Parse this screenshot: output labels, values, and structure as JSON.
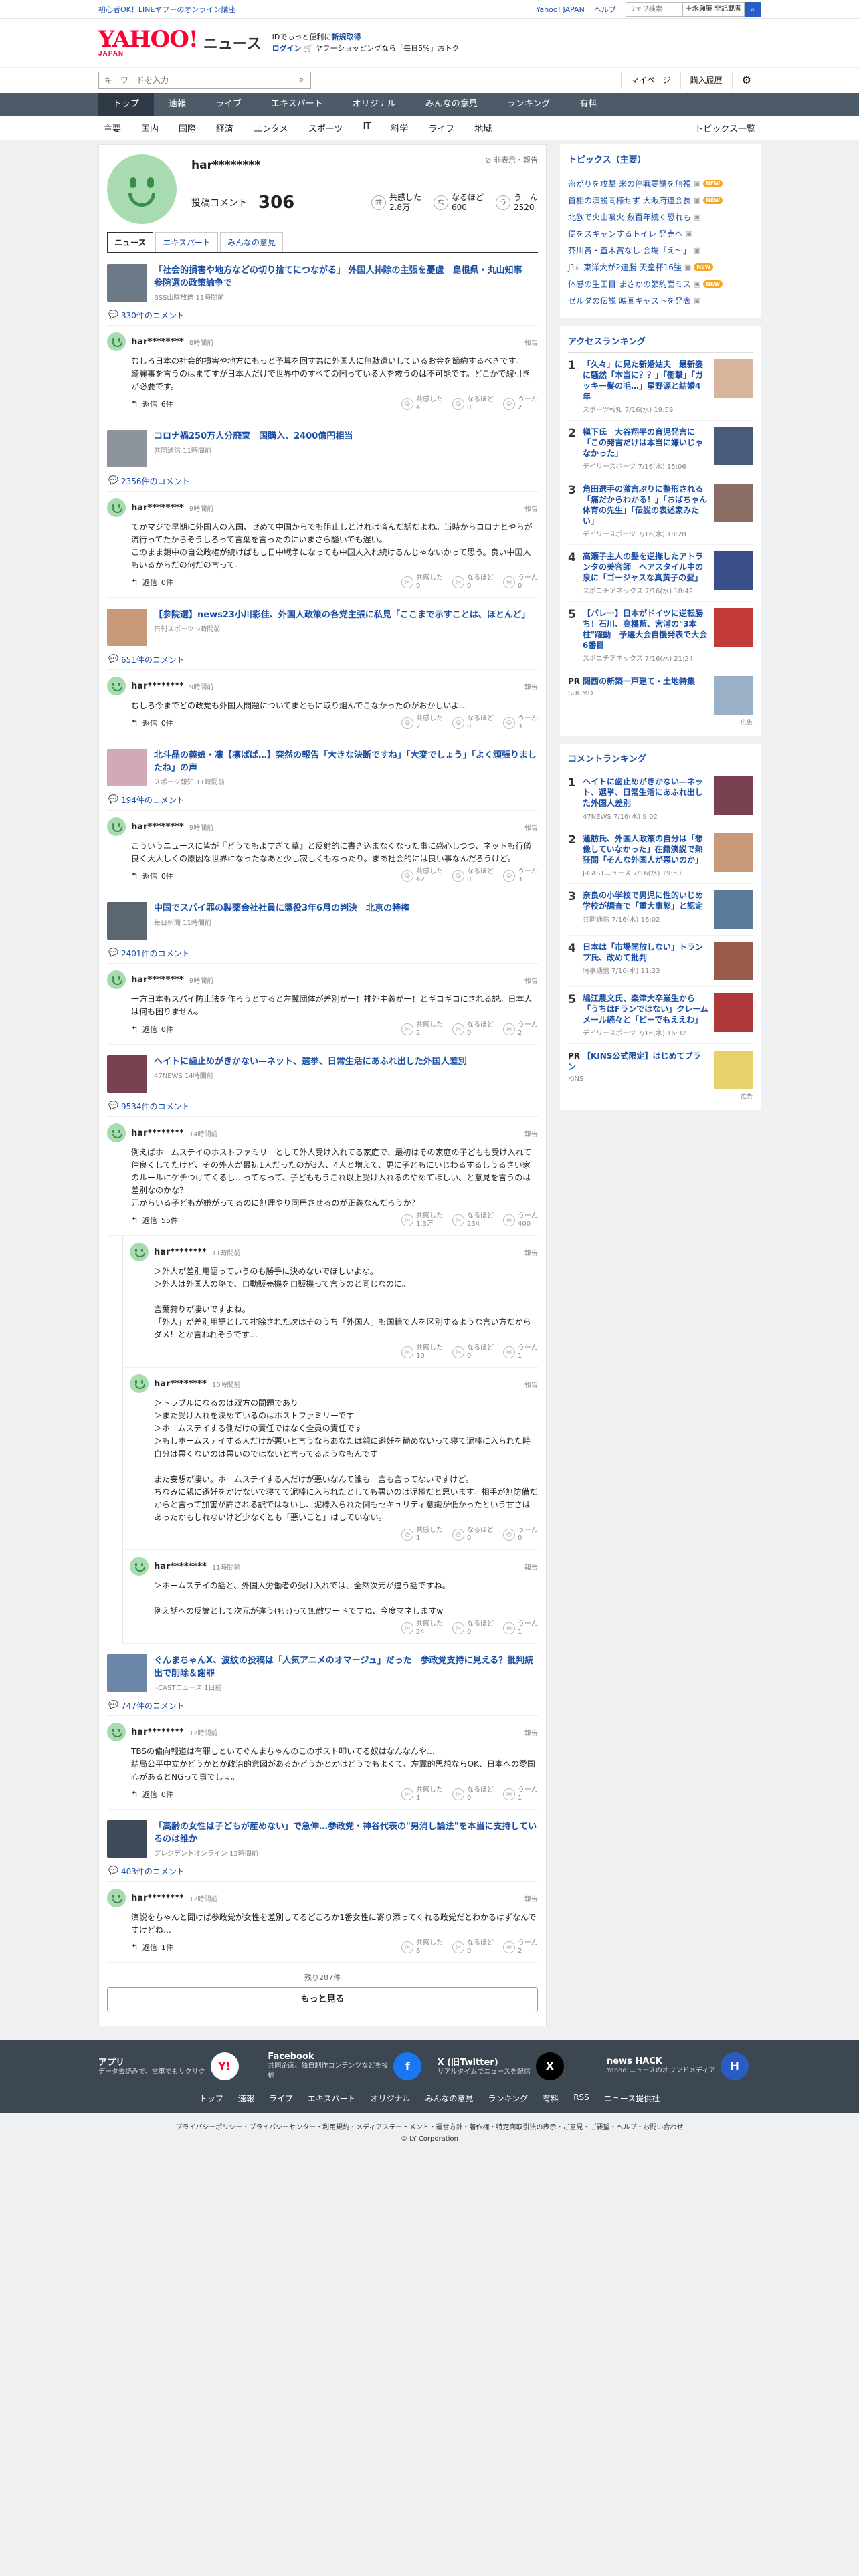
{
  "topbar": {
    "promo": "初心者OK！LINEヤフーのオンライン講座",
    "links": [
      "Yahoo! JAPAN",
      "ヘルプ"
    ],
    "search_placeholder": "ウェブ検索",
    "search_scope": "＋永瀬廉 非記載者"
  },
  "header": {
    "logo": "YAHOO!",
    "logo_sub": "JAPAN",
    "product": "ニュース",
    "msg1": "IDでもっと便利に",
    "msg1_link": "新規取得",
    "msg2_login": "ログイン",
    "msg2_rest": "ヤフーショッピングなら「毎日5%」おトク"
  },
  "search": {
    "placeholder": "キーワードを入力",
    "links": [
      "マイページ",
      "購入履歴"
    ]
  },
  "nav": [
    "トップ",
    "速報",
    "ライブ",
    "エキスパート",
    "オリジナル",
    "みんなの意見",
    "ランキング",
    "有料"
  ],
  "subnav": [
    "主要",
    "国内",
    "国際",
    "経済",
    "エンタメ",
    "スポーツ",
    "IT",
    "科学",
    "ライフ",
    "地域"
  ],
  "subnav_all": "トピックス一覧",
  "profile": {
    "name": "har********",
    "report": "非表示・報告",
    "comments_label": "投稿コメント",
    "comments_count": "306",
    "reacts": [
      {
        "icon": "共",
        "label": "共感した",
        "value": "2.8万"
      },
      {
        "icon": "な",
        "label": "なるほど",
        "value": "600"
      },
      {
        "icon": "う",
        "label": "うーん",
        "value": "2520"
      }
    ],
    "tabs": [
      "ニュース",
      "エキスパート",
      "みんなの意見"
    ]
  },
  "labels": {
    "reply": "返信",
    "report": "報告",
    "agree": "共感した",
    "naruhodo": "なるほど",
    "uun": "うーん"
  },
  "entries": [
    {
      "title": "「社会的損害や地方などの切り捨てにつながる」 外国人排除の主張を憂慮　島根県・丸山知事　参院選の政策論争で",
      "source": "BSS山陰放送 11時間前",
      "thumb": "#6c7a88",
      "count": "330件のコメント",
      "comments": [
        {
          "name": "har********",
          "time": "8時間前",
          "body": "むしろ日本の社会的損害や地方にもっと予算を回す為に外国人に無駄遣いしているお金を節約するべきです。\n綺麗事を言うのはまてすが日本人だけで世界中のすべての困っている人を救うのは不可能です。どこかで線引きが必要です。",
          "replies": "6件",
          "agree": "4",
          "naru": "0",
          "uun": "2",
          "reply": false
        }
      ]
    },
    {
      "title": "コロナ禍250万人分廃棄　国購入、2400億円相当",
      "source": "共同通信 11時間前",
      "thumb": "#8d949b",
      "count": "2356件のコメント",
      "comments": [
        {
          "name": "har********",
          "time": "9時間前",
          "body": "てかマジで早期に外国人の入国、せめて中国からでも阻止しとければ済んだ話だよね。当時からコロナとやらが流行ってたからそうしろって言葉を言ったのにいまさら騒いでも遅い。\nこのまま鎖中の自公政権が続けばもし日中戦争になっても中国人入れ続けるんじゃないかって思う。良い中国人もいるからだの何だの言って。",
          "replies": "0件",
          "agree": "0",
          "naru": "0",
          "uun": "0",
          "reply": false
        }
      ]
    },
    {
      "title": "【参院選】news23小川彩佳、外国人政策の各党主張に私見「ここまで示すことは、ほとんど」",
      "source": "日刊スポーツ 9時間前",
      "thumb": "#c99a7a",
      "count": "651件のコメント",
      "comments": [
        {
          "name": "har********",
          "time": "9時間前",
          "body": "むしろ今までどの政党も外国人問題についてまともに取り組んでこなかったのがおかしいよ…",
          "replies": "0件",
          "agree": "2",
          "naru": "0",
          "uun": "3",
          "reply": false
        }
      ]
    },
    {
      "title": "北斗晶の義娘・凛【凛ぱぱ…】突然の報告「大きな決断ですね」「大変でしょう」「よく頑張りましたね」の声",
      "source": "スポーツ報知 11時間前",
      "thumb": "#d4a9b6",
      "count": "194件のコメント",
      "comments": [
        {
          "name": "har********",
          "time": "9時間前",
          "body": "こういうニュースに皆が『どうでもよすぎて草』と反射的に書き込まなくなった事に感心しつつ、ネットも行儀良く大人しくの原因な世界になったなあと少し寂しくもなったり。まあ社会的には良い事なんだろうけど。",
          "replies": "0件",
          "agree": "42",
          "naru": "0",
          "uun": "3",
          "reply": false
        }
      ]
    },
    {
      "title": "中国でスパイ罪の製薬会社社員に懲役3年6月の判決　北京の特権",
      "source": "毎日新聞 11時間前",
      "thumb": "#5c6670",
      "count": "2401件のコメント",
      "comments": [
        {
          "name": "har********",
          "time": "9時間前",
          "body": "一方日本もスパイ防止法を作ろうとすると左翼団体が差別が一！排外主義が一！とギコギコにされる説。日本人は何も困りません。",
          "replies": "0件",
          "agree": "2",
          "naru": "0",
          "uun": "2",
          "reply": false
        }
      ]
    },
    {
      "title": "ヘイトに歯止めがきかない—ネット、選挙、日常生活にあふれ出した外国人差別",
      "source": "47NEWS 14時間前",
      "thumb": "#7a4150",
      "count": "9534件のコメント",
      "comments": [
        {
          "name": "har********",
          "time": "14時間前",
          "body": "例えばホームステイのホストファミリーとして外人受け入れてる家庭で、最初はその家庭の子どもも受け入れて仲良くしてたけど、その外人が最初1人だったのが3人、4人と増えて、更に子どもにいじわるするしうるさい家のルールにケチつけてくるし…ってなって、子どももうこれ以上受け入れるのやめてほしい、と意見を言うのは差別なのかな？\n元からいる子どもが嫌がってるのに無理やり同居させるのが正義なんだろうか？",
          "replies": "55件",
          "agree": "1.3万",
          "naru": "234",
          "uun": "400",
          "reply": false
        },
        {
          "name": "har********",
          "time": "11時間前",
          "body": "＞外人が差別用語っていうのも勝手に決めないでほしいよな。\n＞外人は外国人の略で、自動販売機を自販機って言うのと同じなのに。\n\n言葉狩りが凄いですよね。\n「外人」が差別用語として排除された次はそのうち「外国人」も国籍で人を区別するような言い方だからダメ！とか言われそうです…",
          "replies": "",
          "agree": "10",
          "naru": "0",
          "uun": "1",
          "reply": true
        },
        {
          "name": "har********",
          "time": "10時間前",
          "body": "＞トラブルになるのは双方の問題であり\n＞また受け入れを決めているのはホストファミリーです\n＞ホームステイする側だけの責任ではなく全員の責任です\n＞もしホームステイする人だけが悪いと言うならあなたは親に避妊を勧めないって寝て泥棒に入られた時自分は悪くないのは悪いのではないと言ってるようなもんです\n\nまた妄想が凄い。ホームステイする人だけが悪いなんて誰も一言も言ってないですけど。\nちなみに親に避妊をかけないで寝てて泥棒に入られたとしても悪いのは泥棒だと思います。相手が無防備だからと言って加害が許される訳ではないし、泥棒入られた側もセキュリティ意識が低かったという甘さはあったかもしれないけど少なくとも「悪いこと」はしていない。",
          "replies": "",
          "agree": "1",
          "naru": "0",
          "uun": "0",
          "reply": true
        },
        {
          "name": "har********",
          "time": "11時間前",
          "body": "＞ホームステイの話と、外国人労働者の受け入れでは、全然次元が違う話ですね。\n\n例え話への反論として次元が違う(ｷﾘｯ)って無敵ワードですね、今度マネしますw",
          "replies": "",
          "agree": "24",
          "naru": "0",
          "uun": "1",
          "reply": true
        }
      ]
    },
    {
      "title": "ぐんまちゃんX、波紋の投稿は「人気アニメのオマージュ」だった　参政党支持に見える？批判続出で削除＆謝罪",
      "source": "J-CASTニュース 1日前",
      "thumb": "#6b86a6",
      "count": "747件のコメント",
      "comments": [
        {
          "name": "har********",
          "time": "12時間前",
          "body": "TBSの偏向報道は有罪しといてぐんまちゃんのこのポスト叩いてる奴はなんなんや…\n結局公平中立かどうかとか政治的意図があるかどうかとかはどうでもよくて、左翼的思想ならOK、日本への愛国心があるとNGって事でしょ。",
          "replies": "0件",
          "agree": "1",
          "naru": "0",
          "uun": "1",
          "reply": false
        }
      ]
    },
    {
      "title": "「高齢の女性は子どもが産めない」で急伸…参政党・神谷代表の\"男消し論法\"を本当に支持しているのは誰か",
      "source": "プレジデントオンライン 12時間前",
      "thumb": "#3e4a5a",
      "count": "403件のコメント",
      "comments": [
        {
          "name": "har********",
          "time": "12時間前",
          "body": "演説をちゃんと聞けば参政党が女性を差別してるどころか1番女性に寄り添ってくれる政党だとわかるはずなんですけどね…",
          "replies": "1件",
          "agree": "8",
          "naru": "0",
          "uun": "2",
          "reply": false
        }
      ]
    }
  ],
  "more": {
    "remaining": "残り287件",
    "button": "もっと見る"
  },
  "side": {
    "topics_title": "トピックス（主要）",
    "topics": [
      {
        "text": "盗がりを攻撃 米の停戦要請を無視",
        "new": true
      },
      {
        "text": "首相の演説同様せず 大阪府連会長",
        "new": true
      },
      {
        "text": "北欧で火山噴火 数百年続く恐れも",
        "new": false
      },
      {
        "text": "便をスキャンするトイレ 発売へ",
        "new": false
      },
      {
        "text": "芥川賞・直木賞なし 会場「え～」",
        "new": false
      },
      {
        "text": "J1に東洋大が2連勝 天皇杯16強",
        "new": true
      },
      {
        "text": "体感の生田目 まさかの節約面ミス",
        "new": true
      },
      {
        "text": "ゼルダの伝説 映画キャストを発表",
        "new": false
      }
    ],
    "access_title": "アクセスランキング",
    "access": [
      {
        "rank": "1",
        "title": "「久々」に見た新婚姑夫　最新姿に騒然「本当に？？」「衝撃」「ガッキー髪の毛…」星野源と結婚4年",
        "meta": "スポーツ報知 7/16(水) 19:59",
        "thumb": "#d8b49c"
      },
      {
        "rank": "2",
        "title": "槇下氏　大谷翔平の育児発言に「この発言だけは本当に嫌いじゃなかった」",
        "meta": "デイリースポーツ 7/16(水) 15:06",
        "thumb": "#4a5b7a"
      },
      {
        "rank": "3",
        "title": "角田選手の激言ぶりに整形される「痛だからわかる！」「おばちゃん体育の先生」「伝説の表述家みたい」",
        "meta": "デイリースポーツ 7/16(水) 18:28",
        "thumb": "#8a6d63"
      },
      {
        "rank": "4",
        "title": "高瀬子主人の髪を逆撫したアトランタの美容師　ヘアスタイル中の泉に「ゴージャスな真黄子の髪」",
        "meta": "スポニチアネックス 7/16(水) 18:42",
        "thumb": "#3a4e8a"
      },
      {
        "rank": "5",
        "title": "【バレー】日本がドイツに逆転勝ち！石川、高橋藍、宮浦の\"3本柱\"躍動　予選大会自慢発表で大会6番目",
        "meta": "スポニチアネックス 7/16(水) 21:24",
        "thumb": "#c23a3a"
      }
    ],
    "pr": {
      "badge": "PR",
      "title": "関西の新築一戸建て・土地特集",
      "meta": "SUUMO",
      "thumb": "#9ab0c6"
    },
    "comment_title": "コメントランキング",
    "comments": [
      {
        "rank": "1",
        "title": "ヘイトに歯止めがきかない—ネット、選挙、日常生活にあふれ出した外国人差別",
        "meta": "47NEWS 7/16(水) 9:02",
        "thumb": "#7a4150"
      },
      {
        "rank": "2",
        "title": "蓮舫氏、外国人政策の自分は「想像していなかった」在籍演説で熱狂問「そんな外国人が悪いのか」",
        "meta": "J-CASTニュース 7/16(水) 19:50",
        "thumb": "#c99a7a"
      },
      {
        "rank": "3",
        "title": "奈良の小学校で男児に性的いじめ学校が調査で「重大事態」と認定",
        "meta": "共同通信 7/16(水) 16:02",
        "thumb": "#5a7c9a"
      },
      {
        "rank": "4",
        "title": "日本は「市場開放しない」トランプ氏、改めて批判",
        "meta": "時事通信 7/16(水) 11:33",
        "thumb": "#9a5a4a"
      },
      {
        "rank": "5",
        "title": "鳩江農文氏、楽津大卒業生から「うちはFランではない」クレームメール続々と「ピーでもええわ」",
        "meta": "デイリースポーツ 7/16(水) 16:32",
        "thumb": "#b03a3a"
      }
    ],
    "pr2": {
      "badge": "PR",
      "title": "【KINS公式限定】はじめてプラン",
      "meta": "KINS",
      "thumb": "#e8d06a"
    },
    "ad": "広告"
  },
  "footer": {
    "apps": [
      {
        "title": "アプリ",
        "desc": "データ去読みで、電車でもサクサク",
        "icon": "Y!",
        "color": "#ffffff"
      },
      {
        "title": "Facebook",
        "desc": "共同企画、独自制作コンテンツなどを投稿",
        "icon": "f",
        "color": "#1877f2"
      },
      {
        "title": "X (旧Twitter)",
        "desc": "リアルタイムでニュースを配信",
        "icon": "X",
        "color": "#000000"
      },
      {
        "title": "news HACK",
        "desc": "Yahoo!ニュースのオウンドメディア",
        "icon": "H",
        "color": "#2b5cc4"
      }
    ],
    "nav": [
      "トップ",
      "速報",
      "ライブ",
      "エキスパート",
      "オリジナル",
      "みんなの意見",
      "ランキング",
      "有料",
      "RSS",
      "ニュース提供社"
    ],
    "links": "プライバシーポリシー・プライバシーセンター・利用規約・メディアステートメント・運営方針・著作権・特定商取引法の表示・ご意見・ご要望・ヘルプ・お問い合わせ",
    "copyright": "© LY Corporation"
  }
}
